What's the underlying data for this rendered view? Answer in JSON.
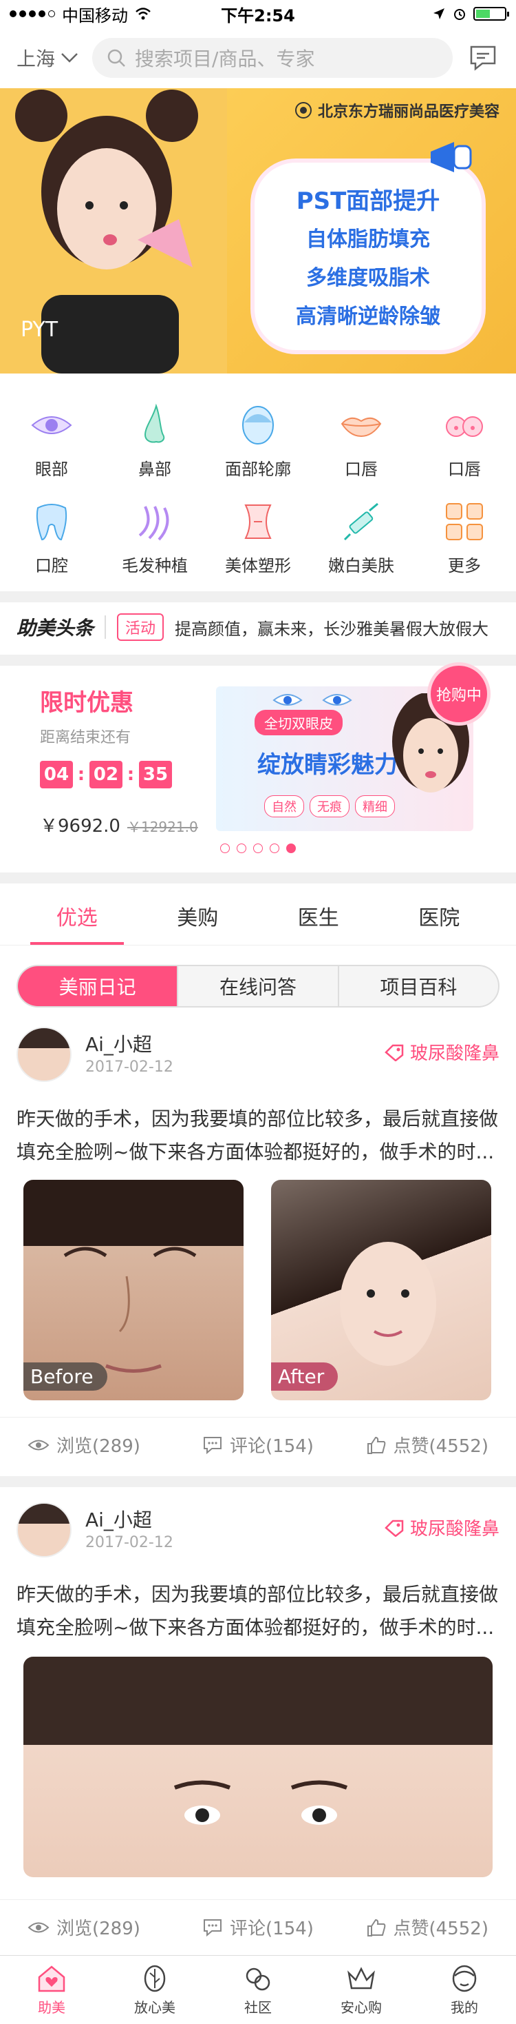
{
  "status": {
    "carrier": "中国移动",
    "time": "下午2:54"
  },
  "header": {
    "city": "上海",
    "search_placeholder": "搜索项目/商品、专家"
  },
  "banner": {
    "brand": "北京东方瑞丽尚品医疗美容",
    "lines": [
      "PST面部提升",
      "自体脂肪填充",
      "多维度吸脂术",
      "高清晰逆龄除皱"
    ]
  },
  "categories": [
    {
      "label": "眼部",
      "icon": "eye-icon"
    },
    {
      "label": "鼻部",
      "icon": "nose-icon"
    },
    {
      "label": "面部轮廓",
      "icon": "face-contour-icon"
    },
    {
      "label": "口唇",
      "icon": "lips-icon"
    },
    {
      "label": "口唇",
      "icon": "breast-icon"
    },
    {
      "label": "口腔",
      "icon": "tooth-icon"
    },
    {
      "label": "毛发种植",
      "icon": "hair-icon"
    },
    {
      "label": "美体塑形",
      "icon": "body-icon"
    },
    {
      "label": "嫩白美肤",
      "icon": "syringe-icon"
    },
    {
      "label": "更多",
      "icon": "grid-icon"
    }
  ],
  "headline": {
    "logo": "助美头条",
    "tag": "活动",
    "text": "提高颜值，赢未来，长沙雅美暑假大放假大"
  },
  "flash_sale": {
    "title": "限时优惠",
    "subtitle": "距离结束还有",
    "hours": "04",
    "minutes": "02",
    "seconds": "35",
    "price": "￥9692.0",
    "original_price": "￥12921.0",
    "promo_line": "全切双眼皮",
    "promo_big": "绽放睛彩魅力",
    "promo_pills": [
      "自然",
      "无痕",
      "精细"
    ],
    "badge": "抢购中"
  },
  "tabs": [
    "优选",
    "美购",
    "医生",
    "医院"
  ],
  "segments": [
    "美丽日记",
    "在线问答",
    "项目百科"
  ],
  "posts": [
    {
      "user": "Ai_小超",
      "date": "2017-02-12",
      "project": "玻尿酸隆鼻",
      "content": "昨天做的手术，因为我要填的部位比较多，最后就直接做填充全脸咧~做下来各方面体验都挺好的，做手术的时...",
      "before_label": "Before",
      "after_label": "After",
      "views": "浏览(289)",
      "comments": "评论(154)",
      "likes": "点赞(4552)"
    },
    {
      "user": "Ai_小超",
      "date": "2017-02-12",
      "project": "玻尿酸隆鼻",
      "content": "昨天做的手术，因为我要填的部位比较多，最后就直接做填充全脸咧~做下来各方面体验都挺好的，做手术的时...",
      "views": "浏览(289)",
      "comments": "评论(154)",
      "likes": "点赞(4552)"
    }
  ],
  "bottom_nav": [
    "助美",
    "放心美",
    "社区",
    "安心购",
    "我的"
  ],
  "colors": {
    "accent": "#ff4f7f",
    "banner": "#f6b93b"
  }
}
